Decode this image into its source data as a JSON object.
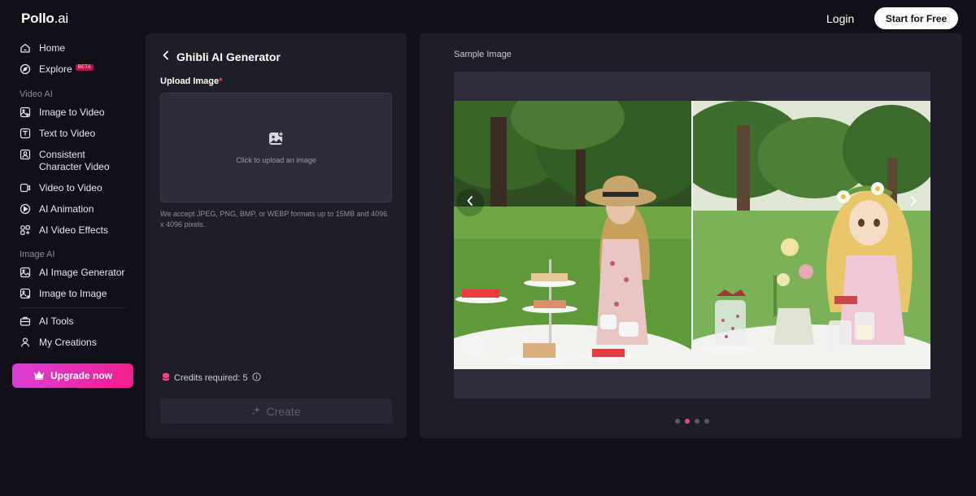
{
  "header": {
    "logo_main": "Pollo",
    "logo_suffix": ".ai",
    "login_label": "Login",
    "start_label": "Start for Free"
  },
  "sidebar": {
    "items": [
      {
        "label": "Home",
        "icon": "home-icon"
      },
      {
        "label": "Explore",
        "icon": "compass-icon",
        "badge": "BETA"
      }
    ],
    "video_section_label": "Video AI",
    "video_items": [
      {
        "label": "Image to Video",
        "icon": "image-video-icon"
      },
      {
        "label": "Text to Video",
        "icon": "text-video-icon"
      },
      {
        "label_line1": "Consistent",
        "label_line2": "Character Video",
        "icon": "character-video-icon"
      },
      {
        "label": "Video to Video",
        "icon": "video-video-icon"
      },
      {
        "label": "AI Animation",
        "icon": "animation-icon"
      },
      {
        "label": "AI Video Effects",
        "icon": "effects-icon"
      }
    ],
    "image_section_label": "Image AI",
    "image_items": [
      {
        "label": "AI Image Generator",
        "icon": "image-generator-icon"
      },
      {
        "label": "Image to Image",
        "icon": "image-to-image-icon"
      }
    ],
    "tools_items": [
      {
        "label": "AI Tools",
        "icon": "toolbox-icon"
      },
      {
        "label": "My Creations",
        "icon": "user-icon"
      }
    ],
    "upgrade_label": "Upgrade now"
  },
  "generator": {
    "title": "Ghibli AI Generator",
    "upload_label": "Upload Image",
    "required_mark": "*",
    "dropzone_hint": "Click to upload an image",
    "accept_note": "We accept JPEG, PNG, BMP, or WEBP formats up to 15MB and 4096 x 4096 pixels.",
    "credits_label": "Credits required: 5",
    "create_label": "Create"
  },
  "sample": {
    "label": "Sample Image",
    "slide_count": 4,
    "active_slide": 2
  },
  "colors": {
    "accent_pink": "#f0457a",
    "upgrade_gradient_start": "#d93fd4",
    "upgrade_gradient_end": "#f21f8e",
    "panel_bg": "#1f1e28",
    "page_bg": "#111018"
  }
}
